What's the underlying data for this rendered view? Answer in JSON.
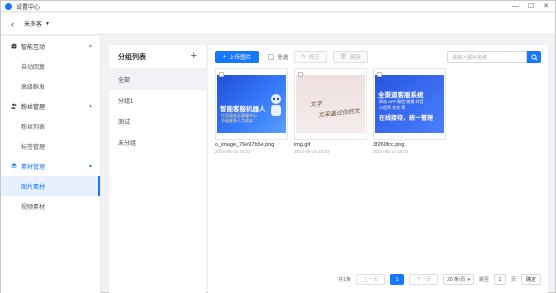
{
  "window": {
    "title": "设置中心",
    "controls": [
      "—",
      "☐",
      "✕"
    ]
  },
  "topbar": {
    "account_name": "米多客"
  },
  "sidebar": {
    "groups": [
      {
        "label": "智能互动",
        "icon": "robot-icon",
        "items": [
          {
            "label": "自动回复"
          },
          {
            "label": "高级群发"
          }
        ]
      },
      {
        "label": "粉丝管理",
        "icon": "users-icon",
        "items": [
          {
            "label": "粉丝列表"
          },
          {
            "label": "标签管理"
          }
        ]
      },
      {
        "label": "素材管理",
        "icon": "layers-icon",
        "items": [
          {
            "label": "图片素材"
          },
          {
            "label": "视频素材"
          }
        ]
      }
    ]
  },
  "categories": {
    "title": "分组列表",
    "items": [
      {
        "label": "全部"
      },
      {
        "label": "分组1"
      },
      {
        "label": "测试"
      },
      {
        "label": "未分组"
      }
    ]
  },
  "toolbar": {
    "upload_label": "上传图片",
    "select_all_label": "全选",
    "edit_label": "修正",
    "delete_label": "删除",
    "search_placeholder": "请输入图片名称"
  },
  "images": [
    {
      "name": "o_image_76e97b5e.png",
      "date": "2022-05-14 10:33",
      "line1": "智能客服机器人",
      "line2": "打造高效无客服中心",
      "line3": "节省更多人力成本"
    },
    {
      "name": "img.gif",
      "date": "2022-05-14 10:33",
      "line1": "文字",
      "line2": "文采盖过你的文"
    },
    {
      "name": "3f260fcc.png",
      "date": "2022-05-14 10:33",
      "line1": "全渠道客服系统",
      "line2": "网站 APP 微信 微博 抖音",
      "line3": "小程序 京东 等",
      "line4": "在线接待，统一管理"
    }
  ],
  "pagination": {
    "total_label": "共1条",
    "prev_label": "上一页",
    "current_page": "1",
    "next_label": "下一页",
    "page_size_label": "20 条/页",
    "goto_label": "跳至",
    "goto_value": "1",
    "page_unit": "页",
    "confirm_label": "确定"
  },
  "colors": {
    "accent": "#1677ff",
    "active_bg": "#e6f0ff"
  }
}
